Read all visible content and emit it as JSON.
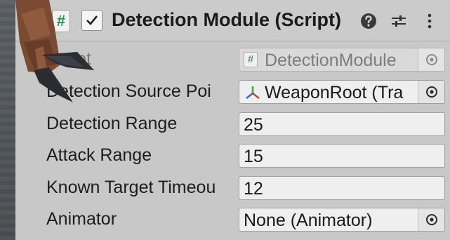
{
  "component": {
    "title": "Detection Module (Script)",
    "enabled": true,
    "icons": {
      "script": "script-icon",
      "help": "help-icon",
      "presets": "presets-icon",
      "menu": "kebab-menu-icon"
    }
  },
  "fields": [
    {
      "label": "Script",
      "value": "DetectionModule",
      "icon": "script-icon",
      "disabled": true,
      "type": "object"
    },
    {
      "label": "Detection Source Poi",
      "value": "WeaponRoot (Tra",
      "icon": "transform-icon",
      "type": "object"
    },
    {
      "label": "Detection Range",
      "value": "25",
      "type": "number"
    },
    {
      "label": "Attack Range",
      "value": "15",
      "type": "number"
    },
    {
      "label": "Known Target Timeou",
      "value": "12",
      "type": "number"
    },
    {
      "label": "Animator",
      "value": "None (Animator)",
      "type": "object"
    }
  ],
  "colors": {
    "panel": "#c8c8c8",
    "field": "#efefef",
    "text": "#1d1d1d",
    "scriptIconGreen": "#2f8a4e"
  }
}
